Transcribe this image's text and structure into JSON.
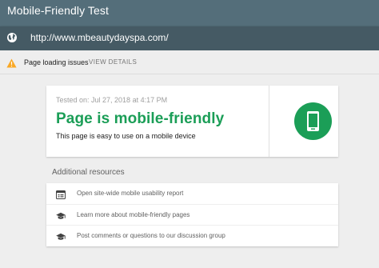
{
  "app": {
    "title": "Mobile-Friendly Test"
  },
  "url_bar": {
    "url": "http://www.mbeautydayspa.com/",
    "icon": "globe-icon"
  },
  "issues": {
    "icon": "warning-icon",
    "label": "Page loading issues",
    "action": "VIEW DETAILS"
  },
  "result": {
    "tested_on": "Tested on: Jul 27, 2018 at 4:17 PM",
    "heading": "Page is mobile-friendly",
    "subtext": "This page is easy to use on a mobile device",
    "icon": "mobile-phone-icon",
    "accent_color": "#1b9e57"
  },
  "resources": {
    "title": "Additional resources",
    "items": [
      {
        "label": "Open site-wide mobile usability report",
        "icon": "report-icon"
      },
      {
        "label": "Learn more about mobile-friendly pages",
        "icon": "school-icon"
      },
      {
        "label": "Post comments or questions to our discussion group",
        "icon": "school-icon"
      }
    ]
  }
}
